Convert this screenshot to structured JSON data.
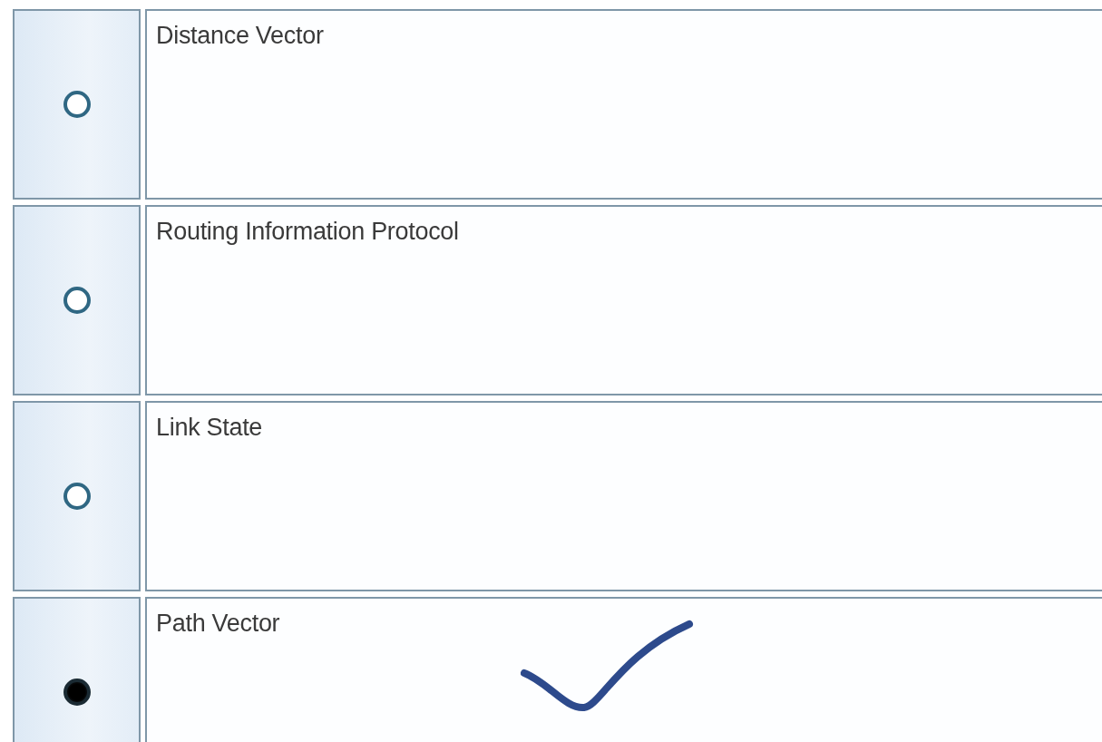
{
  "options": [
    {
      "label": "Distance Vector",
      "selected": false,
      "marked": false
    },
    {
      "label": "Routing Information Protocol",
      "selected": false,
      "marked": false
    },
    {
      "label": "Link State",
      "selected": false,
      "marked": false
    },
    {
      "label": "Path Vector",
      "selected": true,
      "marked": true
    }
  ]
}
